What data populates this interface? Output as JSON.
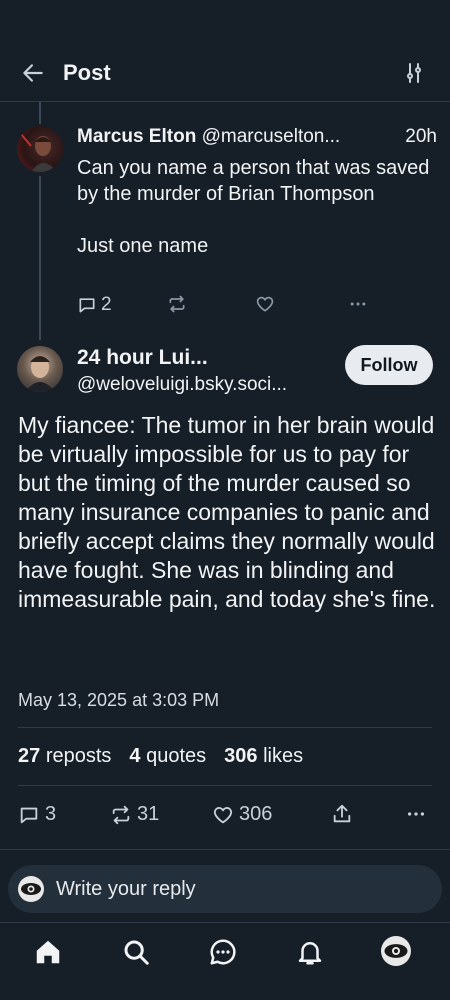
{
  "header": {
    "title": "Post",
    "back_icon": "arrow-left-icon",
    "filter_icon": "tune-icon"
  },
  "parent_post": {
    "display_name": "Marcus Elton",
    "handle": "@marcuselton...",
    "time": "20h",
    "text": "Can you name a person that was saved by the murder of Brian Thompson\n\nJust one name",
    "replies": "2"
  },
  "main_post": {
    "display_name": "24 hour Lui...",
    "handle": "@weloveluigi.bsky.soci...",
    "follow_label": "Follow",
    "text": "My fiancee: The tumor in her brain would be virtually impossible for us to pay for but the timing of the murder caused so many insurance companies to panic and briefly accept claims they normally would have fought. She was in blinding and immeasurable pain, and today she's fine.",
    "date": "May 13, 2025 at 3:03 PM",
    "stats": {
      "reposts_count": "27",
      "reposts_label": "reposts",
      "quotes_count": "4",
      "quotes_label": "quotes",
      "likes_count": "306",
      "likes_label": "likes"
    },
    "actions": {
      "replies": "3",
      "reposts": "31",
      "likes": "306"
    }
  },
  "reply_bar": {
    "placeholder": "Write your reply"
  },
  "nav": [
    "home-icon",
    "search-icon",
    "chat-icon",
    "bell-icon",
    "profile-avatar"
  ],
  "colors": {
    "background": "#161e27",
    "text": "#f1f3f5",
    "muted": "#8b98a8",
    "divider": "#2e3a47"
  }
}
